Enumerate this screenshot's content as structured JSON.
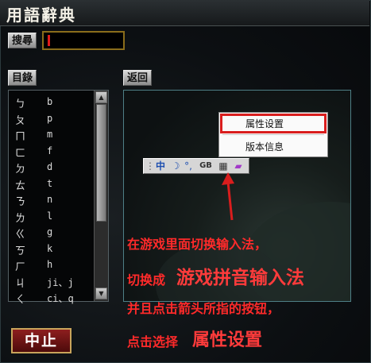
{
  "window": {
    "title": "用語辭典"
  },
  "search": {
    "button_label": "搜尋",
    "value": ""
  },
  "index": {
    "button_label": "目錄"
  },
  "back": {
    "button_label": "返回"
  },
  "phonetic_list": [
    {
      "bopomofo": "ㄅ",
      "pinyin": "b"
    },
    {
      "bopomofo": "ㄆ",
      "pinyin": "p"
    },
    {
      "bopomofo": "ㄇ",
      "pinyin": "m"
    },
    {
      "bopomofo": "ㄈ",
      "pinyin": "f"
    },
    {
      "bopomofo": "ㄉ",
      "pinyin": "d"
    },
    {
      "bopomofo": "ㄊ",
      "pinyin": "t"
    },
    {
      "bopomofo": "ㄋ",
      "pinyin": "n"
    },
    {
      "bopomofo": "ㄌ",
      "pinyin": "l"
    },
    {
      "bopomofo": "ㄍ",
      "pinyin": "g"
    },
    {
      "bopomofo": "ㄎ",
      "pinyin": "k"
    },
    {
      "bopomofo": "ㄏ",
      "pinyin": "h"
    },
    {
      "bopomofo": "ㄐ",
      "pinyin": "ji、j"
    },
    {
      "bopomofo": "ㄑ",
      "pinyin": "ci、q"
    }
  ],
  "stop": {
    "button_label": "中止"
  },
  "ime_toolbar": {
    "gb_label": "GB"
  },
  "context_menu": {
    "items": [
      "属性设置",
      "版本信息"
    ]
  },
  "annotation": {
    "line1": "在游戏里面切换输入法，",
    "line2_prefix": "切换成",
    "line2_highlight": "游戏拼音输入法",
    "line3": "并且点击箭头所指的按钮，",
    "line4_prefix": "点击选择",
    "line4_highlight": "属性设置"
  },
  "colors": {
    "highlight_red": "#d91d1d",
    "annotation_red": "#ff2a2a",
    "accent_gold": "#c9a45b"
  }
}
